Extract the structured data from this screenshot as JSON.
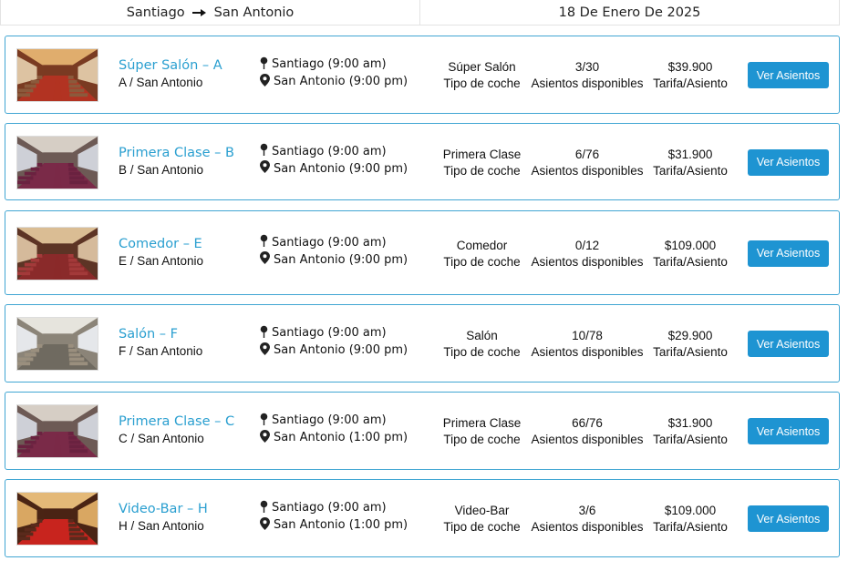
{
  "header": {
    "origin": "Santiago",
    "arrow_icon": "arrow-right-icon",
    "destination": "San Antonio",
    "date": "18 De Enero De 2025"
  },
  "labels": {
    "car_type": "Tipo de coche",
    "seats_available": "Asientos disponibles",
    "fare": "Tarifa/Asiento",
    "button": "Ver Asientos"
  },
  "icons": {
    "origin": "pin-icon",
    "destination": "location-marker-icon"
  },
  "cars": [
    {
      "title": "Súper Salón – A",
      "subtitle": "A / San Antonio",
      "departure": "Santiago (9:00 am)",
      "arrival": "San Antonio (9:00 pm)",
      "car_type": "Súper Salón",
      "seats": "3/30",
      "fare": "$39.900",
      "thumbnail": "photo-super-salon-interior"
    },
    {
      "title": "Primera Clase – B",
      "subtitle": "B / San Antonio",
      "departure": "Santiago (9:00 am)",
      "arrival": "San Antonio (9:00 pm)",
      "car_type": "Primera Clase",
      "seats": "6/76",
      "fare": "$31.900",
      "thumbnail": "photo-primera-clase-interior"
    },
    {
      "title": "Comedor – E",
      "subtitle": "E / San Antonio",
      "departure": "Santiago (9:00 am)",
      "arrival": "San Antonio (9:00 pm)",
      "car_type": "Comedor",
      "seats": "0/12",
      "fare": "$109.000",
      "thumbnail": "photo-comedor-interior"
    },
    {
      "title": "Salón – F",
      "subtitle": "F / San Antonio",
      "departure": "Santiago (9:00 am)",
      "arrival": "San Antonio (9:00 pm)",
      "car_type": "Salón",
      "seats": "10/78",
      "fare": "$29.900",
      "thumbnail": "photo-salon-interior"
    },
    {
      "title": "Primera Clase – C",
      "subtitle": "C / San Antonio",
      "departure": "Santiago (9:00 am)",
      "arrival": "San Antonio (1:00 pm)",
      "car_type": "Primera Clase",
      "seats": "66/76",
      "fare": "$31.900",
      "thumbnail": "photo-primera-clase-interior"
    },
    {
      "title": "Video-Bar – H",
      "subtitle": "H / San Antonio",
      "departure": "Santiago (9:00 am)",
      "arrival": "San Antonio (1:00 pm)",
      "car_type": "Video-Bar",
      "seats": "3/6",
      "fare": "$109.000",
      "thumbnail": "photo-video-bar-interior"
    }
  ],
  "colors": {
    "accent": "#2a9fd0",
    "card_border": "#41a6d3",
    "button": "#1e94d2"
  }
}
